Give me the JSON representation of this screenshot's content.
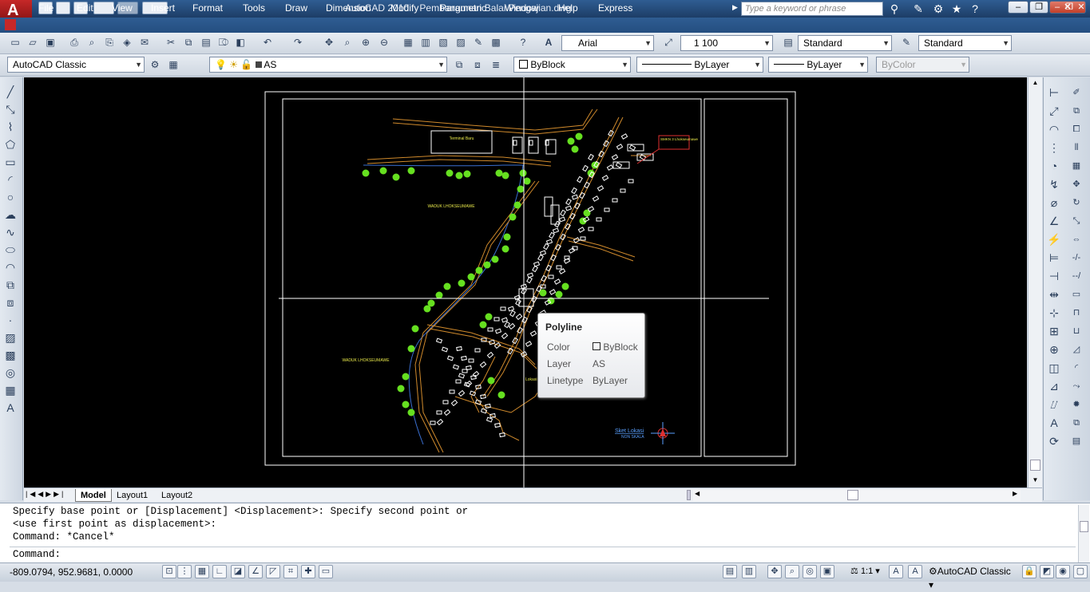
{
  "window": {
    "app_name": "AutoCAD 2010",
    "file_name": "Pembangunan Balai Pengajian.dwg",
    "search_placeholder": "Type a keyword or phrase",
    "logo": "A"
  },
  "menu": [
    "File",
    "Edit",
    "View",
    "Insert",
    "Format",
    "Tools",
    "Draw",
    "Dimension",
    "Modify",
    "Parametric",
    "Window",
    "Help",
    "Express"
  ],
  "toolbar": {
    "text_style_font": "Arial",
    "dim_scale": "1 100",
    "dim_style": "Standard",
    "table_style": "Standard",
    "workspace": "AutoCAD Classic",
    "layer": "AS",
    "color": "ByBlock",
    "linetype": "ByLayer",
    "lineweight": "ByLayer",
    "plot_style": "ByColor"
  },
  "tabs": [
    "Model",
    "Layout1",
    "Layout2"
  ],
  "drawing_labels": {
    "terminal": "Terminal Baru",
    "school": "SMKN 3 Lhokseumawe",
    "lake_top": "WADUK LHOKSEUMAWE",
    "lake_bottom": "WADUK LHOKSEUMAWE",
    "location": "Lokasi",
    "sketch_title": "Sket Lokasi",
    "sketch_scale": "NON SKALA"
  },
  "tooltip": {
    "title": "Polyline",
    "rows": [
      {
        "key": "Color",
        "value": "ByBlock"
      },
      {
        "key": "Layer",
        "value": "AS"
      },
      {
        "key": "Linetype",
        "value": "ByLayer"
      }
    ]
  },
  "command": {
    "history": [
      "Specify base point or [Displacement] <Displacement>: Specify second point or",
      "<use first point as displacement>:",
      "Command: *Cancel*"
    ],
    "prompt": "Command:"
  },
  "status": {
    "coordinates": "-809.0794, 952.9681, 0.0000",
    "annotation_scale": "1:1",
    "workspace": "AutoCAD Classic"
  },
  "colors": {
    "road": "#d08a2c",
    "tree": "#66e020",
    "building": "#ffffff",
    "label": "#e8e84a",
    "accent": "#2f5d92"
  }
}
